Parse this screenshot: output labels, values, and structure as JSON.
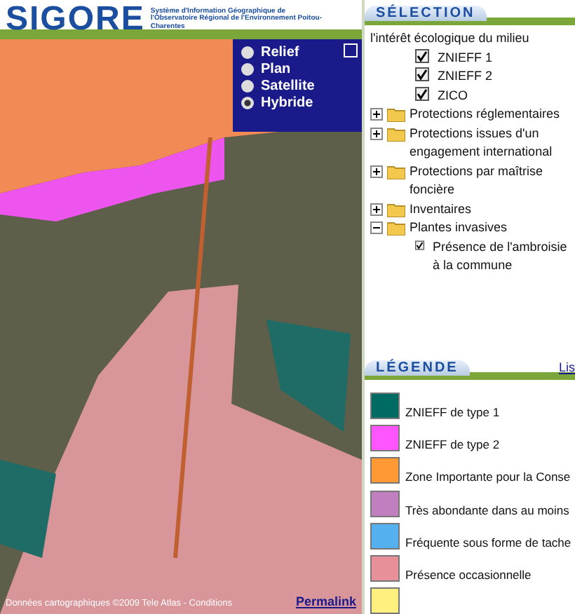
{
  "header": {
    "logo": "SIGORE",
    "subtitle": "Système d'Information Géographique de l'Observatoire Régional de l'Environnement Poitou-Charentes"
  },
  "map": {
    "layers": [
      {
        "label": "Relief",
        "selected": false
      },
      {
        "label": "Plan",
        "selected": false
      },
      {
        "label": "Satellite",
        "selected": false
      },
      {
        "label": "Hybride",
        "selected": true
      }
    ],
    "attribution": "Données cartographiques ©2009 Tele Atlas - Conditions",
    "permalink": "Permalink"
  },
  "selection": {
    "title": "SÉLECTION",
    "tree": [
      {
        "kind": "tail",
        "label": "l'intérêt écologique du milieu",
        "children": [
          {
            "kind": "layer",
            "label": "ZNIEFF 1",
            "checked": true
          },
          {
            "kind": "layer",
            "label": "ZNIEFF 2",
            "checked": true
          },
          {
            "kind": "layer",
            "label": "ZICO",
            "checked": true
          }
        ]
      },
      {
        "kind": "folder",
        "label": "Protections réglementaires",
        "expanded": false
      },
      {
        "kind": "folder",
        "label": "Protections issues d'un engagement international",
        "expanded": false
      },
      {
        "kind": "folder",
        "label": "Protections par maîtrise foncière",
        "expanded": false
      },
      {
        "kind": "folder",
        "label": "Inventaires",
        "expanded": false
      },
      {
        "kind": "folder",
        "label": "Plantes invasives",
        "expanded": true,
        "children": [
          {
            "kind": "layer",
            "label": "Présence de l'ambroisie à la commune",
            "checked": true
          }
        ]
      }
    ]
  },
  "legend": {
    "title": "LÉGENDE",
    "link": "Lis",
    "items": [
      {
        "label": "ZNIEFF de type 1",
        "color": "#006b63"
      },
      {
        "label": "ZNIEFF de type 2",
        "color": "#ff55ff"
      },
      {
        "label": "Zone Importante pour la Conse",
        "color": "#ff9933"
      },
      {
        "label": "Très abondante dans au moins",
        "color": "#c080c0"
      },
      {
        "label": "Fréquente sous forme de tache",
        "color": "#55b0f0"
      },
      {
        "label": "Présence occasionnelle",
        "color": "#e8909a"
      },
      {
        "color": "#fff080"
      }
    ]
  }
}
